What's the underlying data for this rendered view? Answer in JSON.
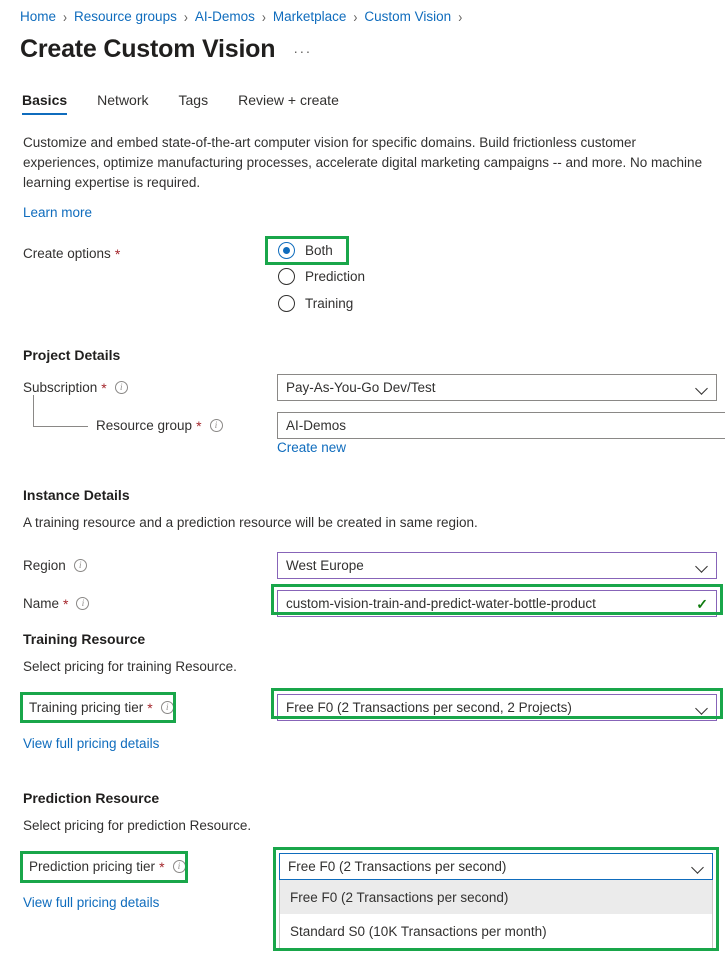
{
  "breadcrumb": {
    "separator": "›",
    "items": [
      {
        "label": "Home"
      },
      {
        "label": "Resource groups"
      },
      {
        "label": "AI-Demos"
      },
      {
        "label": "Marketplace"
      },
      {
        "label": "Custom Vision"
      }
    ]
  },
  "header": {
    "title": "Create Custom Vision",
    "more_label": "···"
  },
  "tabs": [
    {
      "label": "Basics",
      "active": true
    },
    {
      "label": "Network",
      "active": false
    },
    {
      "label": "Tags",
      "active": false
    },
    {
      "label": "Review + create",
      "active": false
    }
  ],
  "intro": {
    "description": "Customize and embed state-of-the-art computer vision for specific domains. Build frictionless customer experiences, optimize manufacturing processes, accelerate digital marketing campaigns -- and more. No machine learning expertise is required.",
    "learn_more": "Learn more"
  },
  "create_options": {
    "label": "Create options",
    "required_mark": "*",
    "options": [
      {
        "label": "Both",
        "checked": true
      },
      {
        "label": "Prediction",
        "checked": false
      },
      {
        "label": "Training",
        "checked": false
      }
    ]
  },
  "project_details": {
    "heading": "Project Details",
    "subscription": {
      "label": "Subscription",
      "required_mark": "*",
      "value": "Pay-As-You-Go Dev/Test"
    },
    "resource_group": {
      "label": "Resource group",
      "required_mark": "*",
      "value": "AI-Demos",
      "create_new": "Create new"
    }
  },
  "instance_details": {
    "heading": "Instance Details",
    "subtext": "A training resource and a prediction resource will be created in same region.",
    "region": {
      "label": "Region",
      "value": "West Europe"
    },
    "name": {
      "label": "Name",
      "required_mark": "*",
      "value": "custom-vision-train-and-predict-water-bottle-product",
      "validation_glyph": "✓"
    }
  },
  "training_resource": {
    "heading": "Training Resource",
    "subtext": "Select pricing for training Resource.",
    "pricing_tier": {
      "label": "Training pricing tier",
      "required_mark": "*",
      "value": "Free F0 (2 Transactions per second, 2 Projects)"
    },
    "pricing_link": "View full pricing details"
  },
  "prediction_resource": {
    "heading": "Prediction Resource",
    "subtext": "Select pricing for prediction Resource.",
    "pricing_tier": {
      "label": "Prediction pricing tier",
      "required_mark": "*",
      "value": "Free F0 (2 Transactions per second)",
      "options": [
        {
          "label": "Free F0 (2 Transactions per second)",
          "highlighted": true
        },
        {
          "label": "Standard S0 (10K Transactions per month)",
          "highlighted": false
        }
      ]
    },
    "pricing_link": "View full pricing details"
  },
  "icons": {
    "info": "i",
    "chevron_down": "chevron-down-icon"
  },
  "colors": {
    "link": "#0f6cbd",
    "accent": "#0f6cbd",
    "required": "#a4262c",
    "highlight_box": "#19a64a",
    "field_border_focus": "#8764b8",
    "success": "#107c10"
  }
}
